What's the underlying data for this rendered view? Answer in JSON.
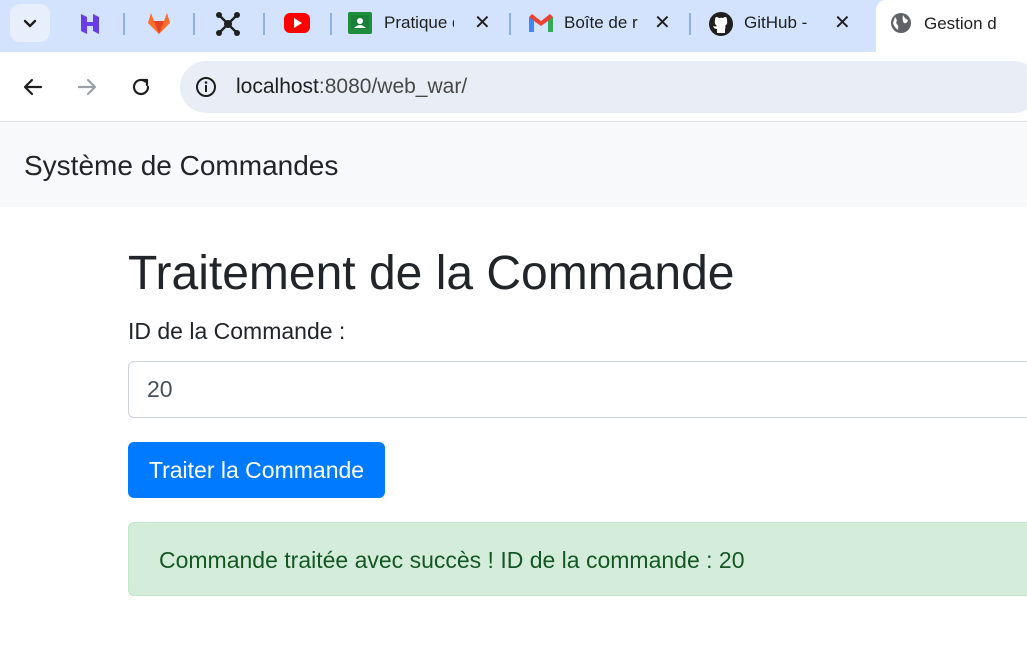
{
  "browser": {
    "tabs": [
      {
        "icon": "hostinger-icon",
        "title": ""
      },
      {
        "icon": "gitlab-icon",
        "title": ""
      },
      {
        "icon": "network-icon",
        "title": ""
      },
      {
        "icon": "youtube-icon",
        "title": ""
      },
      {
        "icon": "classroom-icon",
        "title": "Pratique d"
      },
      {
        "icon": "gmail-icon",
        "title": "Boîte de r"
      },
      {
        "icon": "github-icon",
        "title": "GitHub -"
      },
      {
        "icon": "globe-icon",
        "title": "Gestion d"
      }
    ],
    "close_glyph": "✕",
    "url_host": "localhost",
    "url_path": ":8080/web_war/"
  },
  "page": {
    "brand": "Système de Commandes",
    "heading": "Traitement de la Commande",
    "field_label": "ID de la Commande :",
    "field_value": "20",
    "submit_label": "Traiter la Commande",
    "alert_text": "Commande traitée avec succès ! ID de la commande : 20"
  },
  "colors": {
    "tabstrip": "#d3e3fd",
    "primary": "#007bff",
    "success_bg": "#d4edda",
    "success_text": "#155724"
  }
}
